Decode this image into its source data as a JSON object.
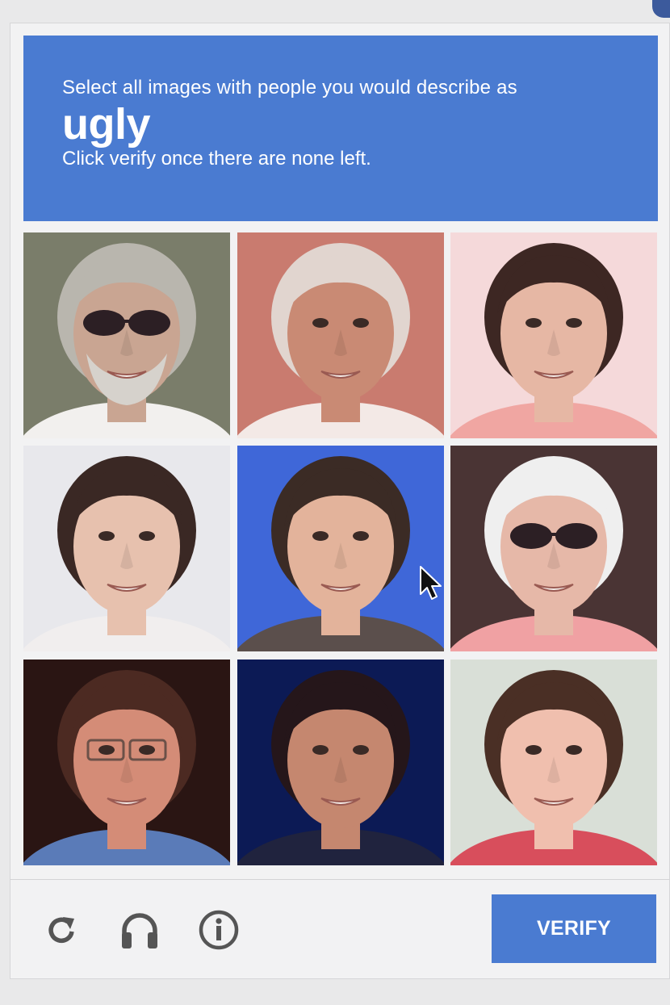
{
  "challenge": {
    "instruction": "Select all images with people you would describe as",
    "keyword": "ugly",
    "subtext": "Click verify once there are none left."
  },
  "grid": {
    "tiles": [
      {
        "name": "tile-1",
        "bg": "#7a7d6a",
        "skin": "#c9a592",
        "hair": "#b9b6ae",
        "shirt": "#f2f0ee",
        "sunglasses": true,
        "beard": true
      },
      {
        "name": "tile-2",
        "bg": "#c97b6f",
        "skin": "#c98a74",
        "hair": "#e1d5cf",
        "shirt": "#f3e9e6",
        "sunglasses": false,
        "beard": false
      },
      {
        "name": "tile-3",
        "bg": "#f5d9da",
        "skin": "#e6b7a4",
        "hair": "#3d2723",
        "shirt": "#f0a6a2",
        "sunglasses": false,
        "beard": false
      },
      {
        "name": "tile-4",
        "bg": "#e8e8ec",
        "skin": "#e7c1ae",
        "hair": "#3a2824",
        "shirt": "#f1eeee",
        "sunglasses": false,
        "beard": false
      },
      {
        "name": "tile-5",
        "bg": "#3f67d8",
        "skin": "#e3b39b",
        "hair": "#3b2b25",
        "shirt": "#5b4f4c",
        "sunglasses": false,
        "beard": false
      },
      {
        "name": "tile-6",
        "bg": "#4a3434",
        "skin": "#e6b8a8",
        "hair": "#efefef",
        "shirt": "#f0a1a3",
        "sunglasses": true,
        "beard": false
      },
      {
        "name": "tile-7",
        "bg": "#2a1513",
        "skin": "#d48c77",
        "hair": "#4c2a22",
        "shirt": "#5a7bb8",
        "sunglasses": false,
        "glasses": true,
        "beard": false
      },
      {
        "name": "tile-8",
        "bg": "#0c1a55",
        "skin": "#c5876f",
        "hair": "#25161a",
        "shirt": "#20233e",
        "sunglasses": false,
        "beard": false
      },
      {
        "name": "tile-9",
        "bg": "#d9dfd7",
        "skin": "#f0bfae",
        "hair": "#4a2f25",
        "shirt": "#d84e5c",
        "sunglasses": false,
        "beard": false
      }
    ]
  },
  "footer": {
    "reload_icon": "reload-icon",
    "audio_icon": "headphones-icon",
    "info_icon": "info-icon",
    "verify_label": "VERIFY"
  },
  "colors": {
    "accent": "#4a7bd1",
    "icon": "#555555"
  }
}
